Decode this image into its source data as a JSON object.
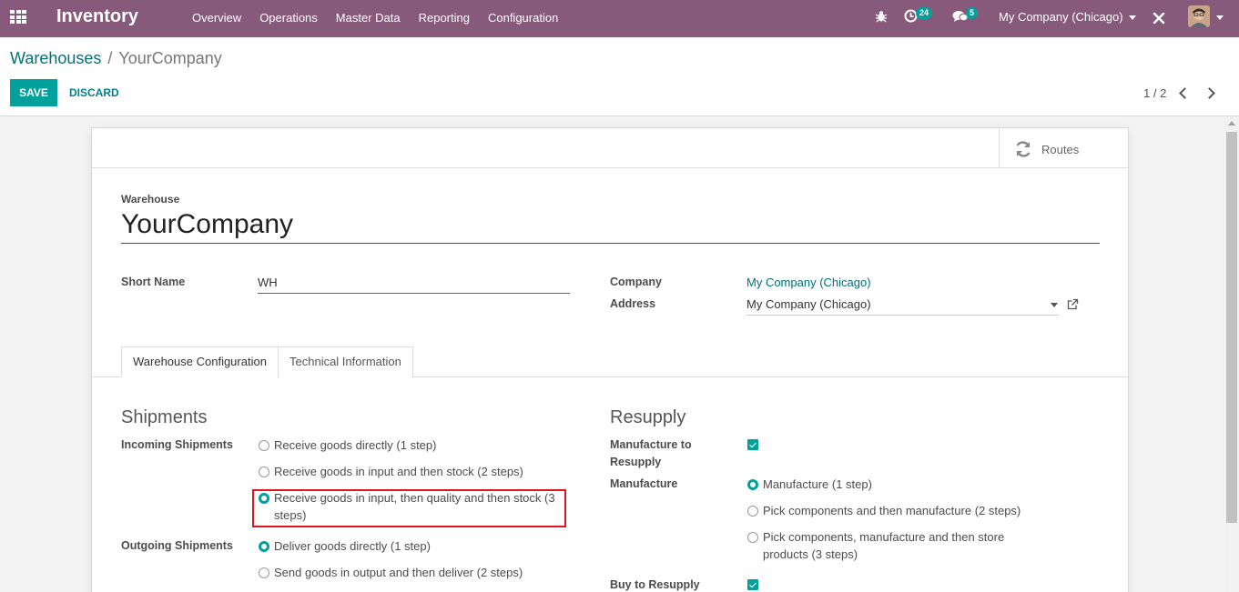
{
  "topbar": {
    "app_name": "Inventory",
    "menu": [
      "Overview",
      "Operations",
      "Master Data",
      "Reporting",
      "Configuration"
    ],
    "activity_count": "24",
    "message_count": "5",
    "company_switcher": "My Company (Chicago)"
  },
  "control_panel": {
    "breadcrumb_parent": "Warehouses",
    "breadcrumb_separator": "/",
    "breadcrumb_current": "YourCompany",
    "save_label": "SAVE",
    "discard_label": "DISCARD",
    "pager": "1 / 2"
  },
  "form": {
    "routes_button": "Routes",
    "warehouse_label": "Warehouse",
    "warehouse_name": "YourCompany",
    "short_name_label": "Short Name",
    "short_name_value": "WH",
    "company_label": "Company",
    "company_value": "My Company (Chicago)",
    "address_label": "Address",
    "address_value": "My Company (Chicago)",
    "tabs": [
      "Warehouse Configuration",
      "Technical Information"
    ],
    "shipments": {
      "title": "Shipments",
      "incoming_label": "Incoming Shipments",
      "incoming_options": [
        {
          "label": "Receive goods directly (1 step)",
          "selected": false
        },
        {
          "label": "Receive goods in input and then stock (2 steps)",
          "selected": false
        },
        {
          "label": "Receive goods in input, then quality and then stock (3 steps)",
          "selected": true
        }
      ],
      "outgoing_label": "Outgoing Shipments",
      "outgoing_options": [
        {
          "label": "Deliver goods directly (1 step)",
          "selected": true
        },
        {
          "label": "Send goods in output and then deliver (2 steps)",
          "selected": false
        }
      ]
    },
    "resupply": {
      "title": "Resupply",
      "manufacture_to_resupply_label": "Manufacture to Resupply",
      "manufacture_to_resupply_checked": true,
      "manufacture_label": "Manufacture",
      "manufacture_options": [
        {
          "label": "Manufacture (1 step)",
          "selected": true
        },
        {
          "label": "Pick components and then manufacture (2 steps)",
          "selected": false
        },
        {
          "label": "Pick components, manufacture and then store products (3 steps)",
          "selected": false
        }
      ],
      "buy_to_resupply_label": "Buy to Resupply",
      "buy_to_resupply_checked": true
    }
  },
  "colors": {
    "topbar": "#875a7b",
    "accent": "#00a09d",
    "link": "#00707a",
    "highlight": "#e0141e"
  }
}
